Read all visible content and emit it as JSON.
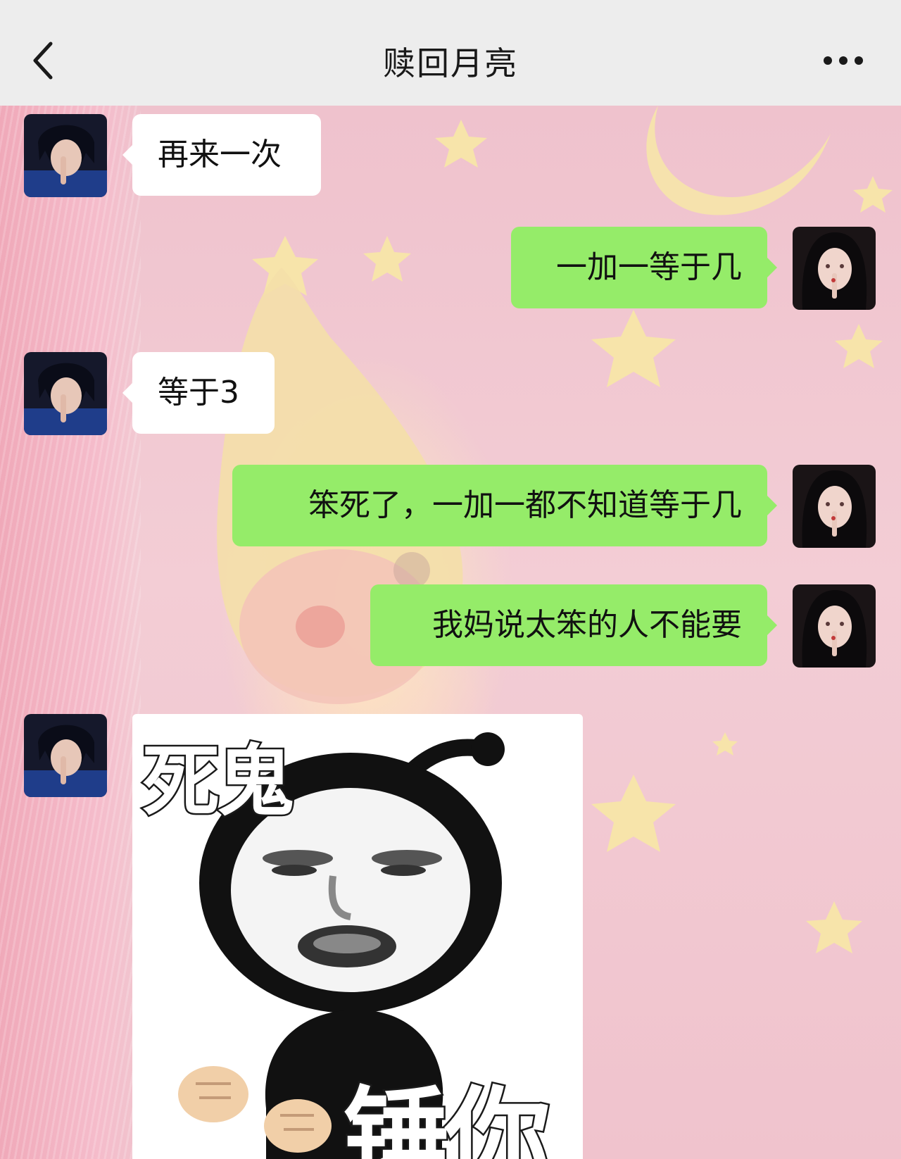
{
  "header": {
    "title": "赎回月亮",
    "back_icon": "chevron-left-icon",
    "more_icon": "ellipsis-icon"
  },
  "messages": [
    {
      "side": "in",
      "type": "text",
      "text": "再来一次"
    },
    {
      "side": "out",
      "type": "text",
      "text": "一加一等于几"
    },
    {
      "side": "in",
      "type": "text",
      "text": "等于3"
    },
    {
      "side": "out",
      "type": "text",
      "text": "笨死了，一加一都不知道等于几"
    },
    {
      "side": "out",
      "type": "text",
      "text": "我妈说太笨的人不能要"
    },
    {
      "side": "in",
      "type": "sticker",
      "top_text": "死鬼",
      "bottom_text": "锤你"
    }
  ],
  "colors": {
    "topbar": "#ededed",
    "outgoing_bubble": "#95ec69",
    "incoming_bubble": "#ffffff",
    "wallpaper": "#f1c9d2"
  }
}
